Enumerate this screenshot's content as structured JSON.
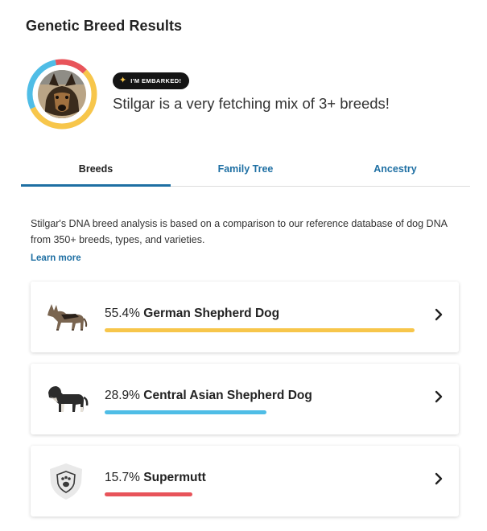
{
  "page": {
    "title": "Genetic Breed Results"
  },
  "profile": {
    "badge_label": "I'M EMBARKED!",
    "headline": "Stilgar is a very fetching mix of 3+ breeds!",
    "ring_colors": [
      "#f7c64b",
      "#4fbde6",
      "#e8545a"
    ]
  },
  "tabs": [
    {
      "label": "Breeds",
      "active": true
    },
    {
      "label": "Family Tree",
      "active": false
    },
    {
      "label": "Ancestry",
      "active": false
    }
  ],
  "intro": {
    "text": "Stilgar's DNA breed analysis is based on a comparison to our reference database of dog DNA from 350+ breeds, types, and varieties.",
    "learn_more": "Learn more"
  },
  "breeds": [
    {
      "percent": "55.4%",
      "name": "German Shepherd Dog",
      "share": 55.4,
      "color": "#f7c64b",
      "icon": "german-shepherd-dog-illustration"
    },
    {
      "percent": "28.9%",
      "name": "Central Asian Shepherd Dog",
      "share": 28.9,
      "color": "#4fbde6",
      "icon": "central-asian-shepherd-dog-illustration"
    },
    {
      "percent": "15.7%",
      "name": "Supermutt",
      "share": 15.7,
      "color": "#e8545a",
      "icon": "supermutt-paw-shield-icon"
    }
  ],
  "colors": {
    "accent": "#1e6fa3",
    "badge_bg": "#141414"
  }
}
